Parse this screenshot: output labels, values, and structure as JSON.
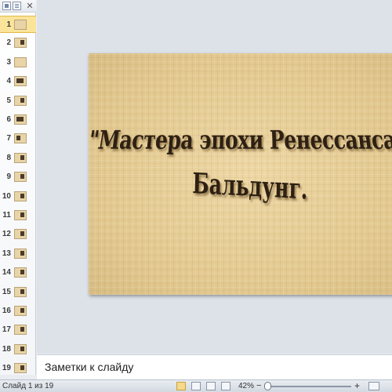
{
  "pane": {
    "close_label": "✕",
    "slides": [
      {
        "number": "1",
        "selected": true
      },
      {
        "number": "2"
      },
      {
        "number": "3"
      },
      {
        "number": "4"
      },
      {
        "number": "5"
      },
      {
        "number": "6"
      },
      {
        "number": "7"
      },
      {
        "number": "8"
      },
      {
        "number": "9"
      },
      {
        "number": "10"
      },
      {
        "number": "11"
      },
      {
        "number": "12"
      },
      {
        "number": "13"
      },
      {
        "number": "14"
      },
      {
        "number": "15"
      },
      {
        "number": "16"
      },
      {
        "number": "17"
      },
      {
        "number": "18"
      },
      {
        "number": "19"
      }
    ]
  },
  "slide": {
    "title_line1": "\"Мастера эпохи Ренессанса\".",
    "title_line2": "Бальдунг.",
    "background_color": "#e6cd96",
    "text_color": "#2d2013"
  },
  "notes": {
    "placeholder": "Заметки к слайду"
  },
  "status_bar": {
    "slide_info": "Слайд 1 из 19",
    "zoom": "42%",
    "zoom_minus": "−",
    "zoom_plus": "+"
  },
  "colors": {
    "selected_thumb": "#f9e49a",
    "accent": "#e3b84a"
  }
}
